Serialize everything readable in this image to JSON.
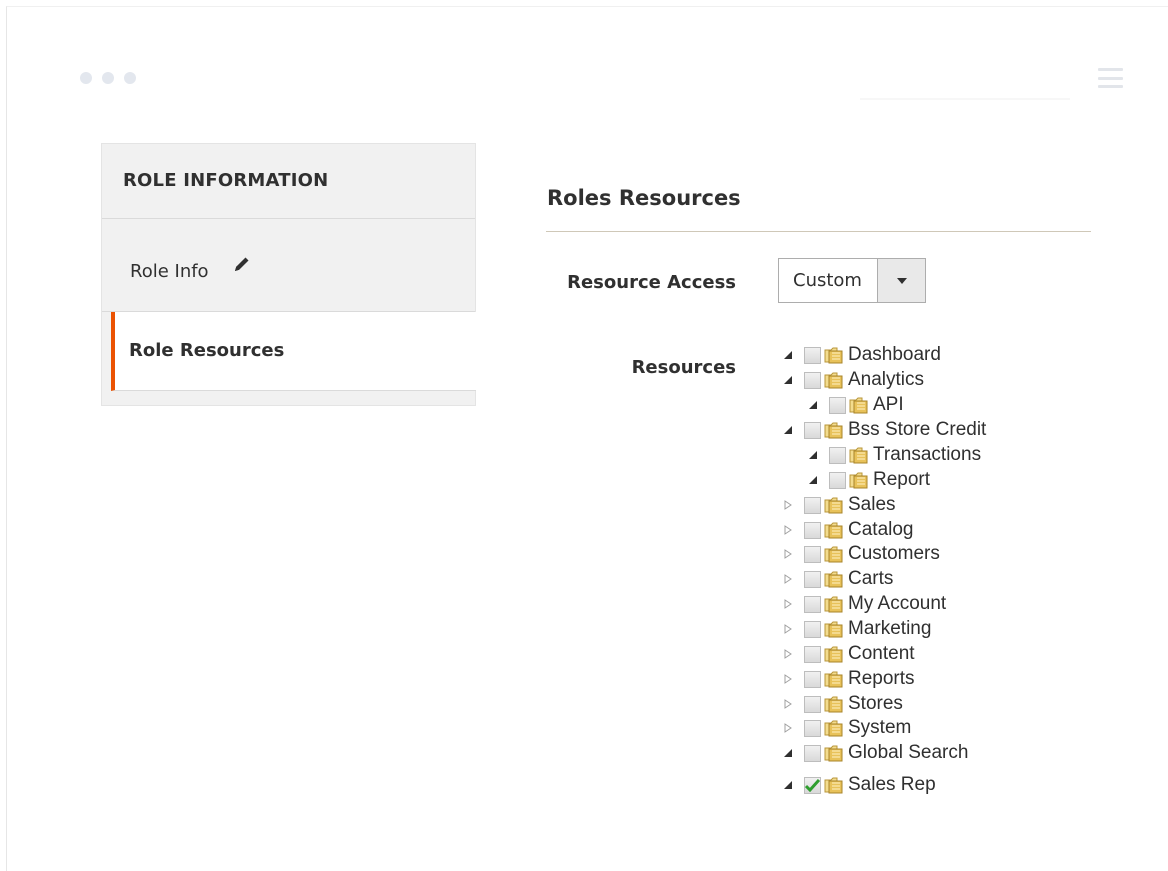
{
  "window": {
    "dots": [
      "dot",
      "dot",
      "dot"
    ],
    "menu_icon": "hamburger-icon"
  },
  "sidebar": {
    "title": "ROLE INFORMATION",
    "items": [
      {
        "label": "Role Info",
        "icon": "pencil-icon",
        "active": false
      },
      {
        "label": "Role Resources",
        "active": true
      }
    ]
  },
  "main": {
    "section_title": "Roles Resources",
    "resource_access": {
      "label": "Resource Access",
      "value": "Custom",
      "icon": "chevron-down-icon"
    },
    "resources": {
      "label": "Resources",
      "tree": [
        {
          "label": "Dashboard",
          "level": 0,
          "expanded": true,
          "checked": false
        },
        {
          "label": "Analytics",
          "level": 0,
          "expanded": true,
          "checked": false
        },
        {
          "label": "API",
          "level": 1,
          "expanded": true,
          "checked": false
        },
        {
          "label": "Bss Store Credit",
          "level": 0,
          "expanded": true,
          "checked": false
        },
        {
          "label": "Transactions",
          "level": 1,
          "expanded": true,
          "checked": false
        },
        {
          "label": "Report",
          "level": 1,
          "expanded": true,
          "checked": false
        },
        {
          "label": "Sales",
          "level": 0,
          "expanded": false,
          "checked": false
        },
        {
          "label": "Catalog",
          "level": 0,
          "expanded": false,
          "checked": false
        },
        {
          "label": "Customers",
          "level": 0,
          "expanded": false,
          "checked": false
        },
        {
          "label": "Carts",
          "level": 0,
          "expanded": false,
          "checked": false
        },
        {
          "label": "My Account",
          "level": 0,
          "expanded": false,
          "checked": false
        },
        {
          "label": "Marketing",
          "level": 0,
          "expanded": false,
          "checked": false
        },
        {
          "label": "Content",
          "level": 0,
          "expanded": false,
          "checked": false
        },
        {
          "label": "Reports",
          "level": 0,
          "expanded": false,
          "checked": false
        },
        {
          "label": "Stores",
          "level": 0,
          "expanded": false,
          "checked": false
        },
        {
          "label": "System",
          "level": 0,
          "expanded": false,
          "checked": false
        },
        {
          "label": "Global Search",
          "level": 0,
          "expanded": true,
          "checked": false
        },
        {
          "label": "Sales Rep",
          "level": 0,
          "expanded": true,
          "checked": true
        }
      ]
    }
  },
  "colors": {
    "accent": "#eb5202",
    "check": "#2f9e2f",
    "folder": "#e8c25a"
  }
}
